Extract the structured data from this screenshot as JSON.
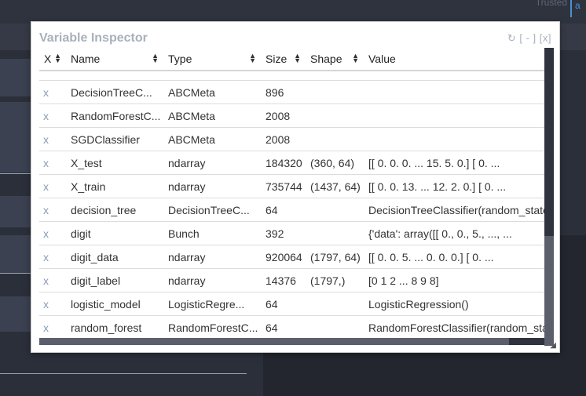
{
  "header": {
    "trusted_label": "Trusted",
    "kernel_edge": "a"
  },
  "inspector": {
    "title": "Variable Inspector",
    "controls": {
      "refresh": "↻",
      "minimize": "[ - ]",
      "close": "[x]"
    },
    "columns": [
      "X",
      "Name",
      "Type",
      "Size",
      "Shape",
      "Value"
    ],
    "rows": [
      {
        "x": "x",
        "name": "DecisionTreeC...",
        "type": "ABCMeta",
        "size": "896",
        "shape": "",
        "value": ""
      },
      {
        "x": "x",
        "name": "RandomForestC...",
        "type": "ABCMeta",
        "size": "2008",
        "shape": "",
        "value": ""
      },
      {
        "x": "x",
        "name": "SGDClassifier",
        "type": "ABCMeta",
        "size": "2008",
        "shape": "",
        "value": ""
      },
      {
        "x": "x",
        "name": "X_test",
        "type": "ndarray",
        "size": "184320",
        "shape": "(360, 64)",
        "value": "[[ 0. 0. 0. ... 15. 5. 0.] [ 0. ..."
      },
      {
        "x": "x",
        "name": "X_train",
        "type": "ndarray",
        "size": "735744",
        "shape": "(1437, 64)",
        "value": "[[ 0. 0. 13. ... 12. 2. 0.] [ 0. ..."
      },
      {
        "x": "x",
        "name": "decision_tree",
        "type": "DecisionTreeC...",
        "size": "64",
        "shape": "",
        "value": "DecisionTreeClassifier(random_state"
      },
      {
        "x": "x",
        "name": "digit",
        "type": "Bunch",
        "size": "392",
        "shape": "",
        "value": "{'data': array([[ 0., 0., 5., ..., ..."
      },
      {
        "x": "x",
        "name": "digit_data",
        "type": "ndarray",
        "size": "920064",
        "shape": "(1797, 64)",
        "value": "[[ 0. 0. 5. ... 0. 0. 0.] [ 0. ..."
      },
      {
        "x": "x",
        "name": "digit_label",
        "type": "ndarray",
        "size": "14376",
        "shape": "(1797,)",
        "value": "[0 1 2 ... 8 9 8]"
      },
      {
        "x": "x",
        "name": "logistic_model",
        "type": "LogisticRegre...",
        "size": "64",
        "shape": "",
        "value": "LogisticRegression()"
      },
      {
        "x": "x",
        "name": "random_forest",
        "type": "RandomForestC...",
        "size": "64",
        "shape": "",
        "value": "RandomForestClassifier(random_state"
      }
    ]
  }
}
